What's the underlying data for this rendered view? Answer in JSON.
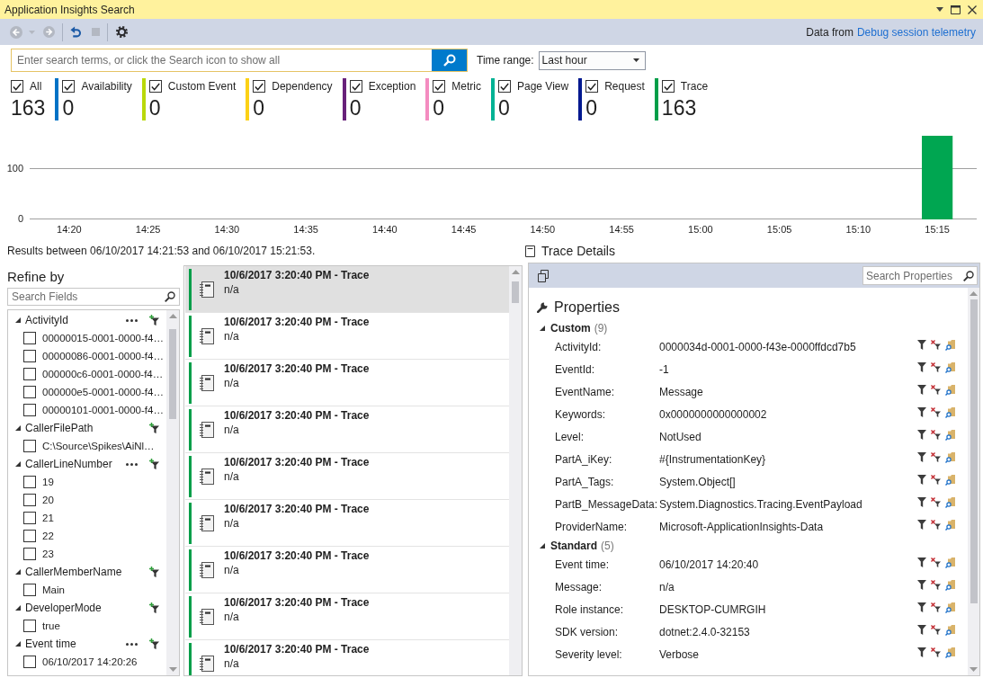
{
  "window": {
    "title": "Application Insights Search"
  },
  "toolbar": {
    "button_groups": [
      [
        {
          "kind": "back",
          "disabled": true
        },
        {
          "kind": "forward",
          "disabled": true
        }
      ],
      [
        {
          "kind": "refresh",
          "disabled": false
        },
        {
          "kind": "stop",
          "disabled": true
        }
      ],
      [
        {
          "kind": "settings",
          "disabled": false
        }
      ]
    ],
    "source_label": "Data from",
    "source_link": "Debug session telemetry"
  },
  "search": {
    "placeholder": "Enter search terms, or click the Search icon to show all",
    "time_range_label": "Time range:",
    "time_range": "Last hour"
  },
  "type_filters": [
    {
      "label": "All",
      "checked": true,
      "count": "163"
    },
    {
      "label": "Availability",
      "checked": true,
      "count": "0",
      "color": "#0072c6"
    },
    {
      "label": "Custom Event",
      "checked": true,
      "count": "0",
      "color": "#bad80a"
    },
    {
      "label": "Dependency",
      "checked": true,
      "count": "0",
      "color": "#fcd116"
    },
    {
      "label": "Exception",
      "checked": true,
      "count": "0",
      "color": "#68217a"
    },
    {
      "label": "Metric",
      "checked": true,
      "count": "0",
      "color": "#f48cc0"
    },
    {
      "label": "Page View",
      "checked": true,
      "count": "0",
      "color": "#00b294"
    },
    {
      "label": "Request",
      "checked": true,
      "count": "0",
      "color": "#00188f"
    },
    {
      "label": "Trace",
      "checked": true,
      "count": "163",
      "color": "#009e49"
    }
  ],
  "timeline": {
    "chart_data": [
      {
        "type": "bar",
        "categories": [
          "14:20",
          "14:25",
          "14:30",
          "14:35",
          "14:40",
          "14:45",
          "14:50",
          "14:55",
          "15:00",
          "15:05",
          "15:10",
          "15:15"
        ],
        "values": [
          0,
          0,
          0,
          0,
          0,
          0,
          0,
          0,
          0,
          0,
          0,
          163
        ],
        "color": "#00a651",
        "yticks": [
          0,
          100
        ],
        "ylim": [
          0,
          163
        ],
        "grid": true
      }
    ]
  },
  "results_summary": "Results between 06/10/2017 14:21:53 and 06/10/2017 15:21:53.",
  "refine": {
    "title": "Refine by",
    "search_placeholder": "Search Fields",
    "fields": [
      {
        "name": "ActivityId",
        "expanded": true,
        "has_more": true,
        "children": [
          {
            "label": "00000015-0001-0000-f4…",
            "checked": false
          },
          {
            "label": "00000086-0001-0000-f4…",
            "checked": false
          },
          {
            "label": "000000c6-0001-0000-f4…",
            "checked": false
          },
          {
            "label": "000000e5-0001-0000-f4…",
            "checked": false
          },
          {
            "label": "00000101-0001-0000-f4…",
            "checked": false
          }
        ]
      },
      {
        "name": "CallerFilePath",
        "expanded": true,
        "has_more": false,
        "children": [
          {
            "label": "C:\\Source\\Spikes\\AiNl…",
            "checked": false
          }
        ]
      },
      {
        "name": "CallerLineNumber",
        "expanded": true,
        "has_more": true,
        "children": [
          {
            "label": "19",
            "checked": false
          },
          {
            "label": "20",
            "checked": false
          },
          {
            "label": "21",
            "checked": false
          },
          {
            "label": "22",
            "checked": false
          },
          {
            "label": "23",
            "checked": false
          }
        ]
      },
      {
        "name": "CallerMemberName",
        "expanded": true,
        "has_more": false,
        "children": [
          {
            "label": "Main",
            "checked": false
          }
        ]
      },
      {
        "name": "DeveloperMode",
        "expanded": true,
        "has_more": false,
        "children": [
          {
            "label": "true",
            "checked": false
          }
        ]
      },
      {
        "name": "Event time",
        "expanded": true,
        "has_more": true,
        "children": [
          {
            "label": "06/10/2017 14:20:26",
            "checked": false
          }
        ]
      }
    ]
  },
  "results": [
    {
      "kind": "trace",
      "title": "10/6/2017 3:20:40 PM - Trace",
      "message": "n/a",
      "selected": true
    },
    {
      "kind": "trace",
      "title": "10/6/2017 3:20:40 PM - Trace",
      "message": "n/a",
      "selected": false
    },
    {
      "kind": "trace",
      "title": "10/6/2017 3:20:40 PM - Trace",
      "message": "n/a",
      "selected": false
    },
    {
      "kind": "trace",
      "title": "10/6/2017 3:20:40 PM - Trace",
      "message": "n/a",
      "selected": false
    },
    {
      "kind": "trace",
      "title": "10/6/2017 3:20:40 PM - Trace",
      "message": "n/a",
      "selected": false
    },
    {
      "kind": "trace",
      "title": "10/6/2017 3:20:40 PM - Trace",
      "message": "n/a",
      "selected": false
    },
    {
      "kind": "trace",
      "title": "10/6/2017 3:20:40 PM - Trace",
      "message": "n/a",
      "selected": false
    },
    {
      "kind": "trace",
      "title": "10/6/2017 3:20:40 PM - Trace",
      "message": "n/a",
      "selected": false
    },
    {
      "kind": "trace",
      "title": "10/6/2017 3:20:40 PM - Trace",
      "message": "n/a",
      "selected": false
    }
  ],
  "details": {
    "title": "Trace Details",
    "search_placeholder": "Search Properties",
    "heading": "Properties",
    "groups": [
      {
        "name": "Custom",
        "count": "(9)",
        "expanded": true,
        "properties": [
          {
            "name": "ActivityId:",
            "value": "0000034d-0001-0000-f43e-0000ffdcd7b5"
          },
          {
            "name": "EventId:",
            "value": "-1"
          },
          {
            "name": "EventName:",
            "value": "Message"
          },
          {
            "name": "Keywords:",
            "value": "0x0000000000000002"
          },
          {
            "name": "Level:",
            "value": "NotUsed"
          },
          {
            "name": "PartA_iKey:",
            "value": "#{InstrumentationKey}"
          },
          {
            "name": "PartA_Tags:",
            "value": "System.Object[]"
          },
          {
            "name": "PartB_MessageData:",
            "value": "System.Diagnostics.Tracing.EventPayload"
          },
          {
            "name": "ProviderName:",
            "value": "Microsoft-ApplicationInsights-Data"
          }
        ]
      },
      {
        "name": "Standard",
        "count": "(5)",
        "expanded": true,
        "properties": [
          {
            "name": "Event time:",
            "value": "06/10/2017 14:20:40"
          },
          {
            "name": "Message:",
            "value": "n/a"
          },
          {
            "name": "Role instance:",
            "value": "DESKTOP-CUMRGIH"
          },
          {
            "name": "SDK version:",
            "value": "dotnet:2.4.0-32153"
          },
          {
            "name": "Severity level:",
            "value": "Verbose"
          }
        ]
      }
    ]
  }
}
